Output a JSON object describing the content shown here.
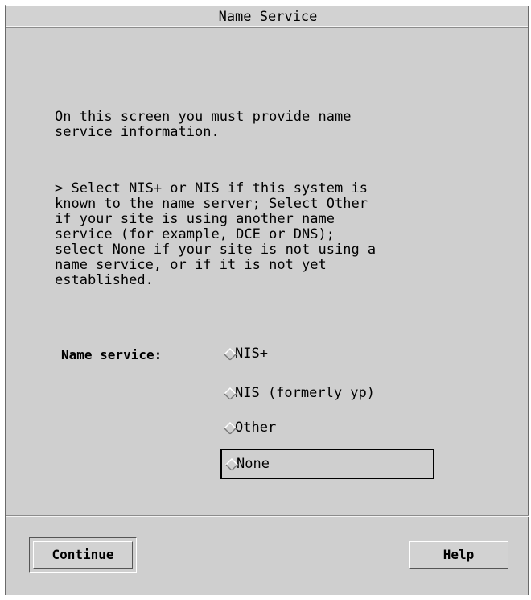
{
  "window": {
    "title": "Name Service"
  },
  "instructions": {
    "paragraph_1": "On this screen you must provide name\nservice information.",
    "paragraph_2": "> Select NIS+ or NIS if this system is\nknown to the name server; Select Other\nif your site is using another name\nservice (for example, DCE or DNS);\nselect None if your site is not using a\nname service, or if it is not yet\nestablished."
  },
  "name_service": {
    "label": "Name service:",
    "options": [
      {
        "label": "NIS+",
        "selected": false
      },
      {
        "label": "NIS (formerly yp)",
        "selected": false
      },
      {
        "label": "Other",
        "selected": false
      },
      {
        "label": "None",
        "selected": false,
        "focused": true
      }
    ]
  },
  "buttons": {
    "continue_label": "Continue",
    "help_label": "Help"
  },
  "icons": {
    "radio": "diamond-radio-icon"
  },
  "colors": {
    "background": "#cfcfcf",
    "text": "#000000",
    "focus_border": "#000000"
  }
}
